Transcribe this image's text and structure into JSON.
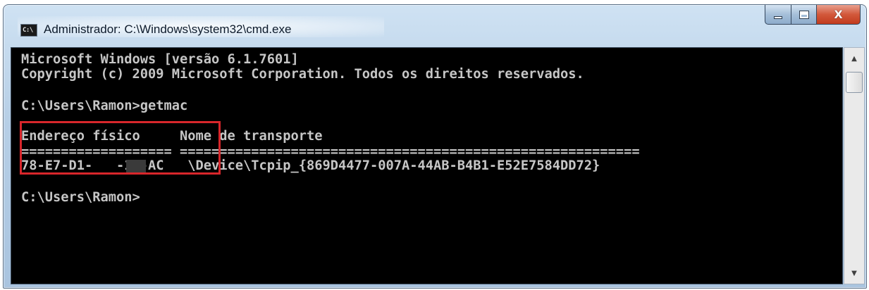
{
  "window": {
    "title": "Administrador: C:\\Windows\\system32\\cmd.exe",
    "icon_text": "C:\\"
  },
  "caption_buttons": {
    "minimize_icon": "minimize-icon",
    "maximize_icon": "maximize-icon",
    "close_glyph": "X"
  },
  "console": {
    "lines": [
      "Microsoft Windows [versão 6.1.7601]",
      "Copyright (c) 2009 Microsoft Corporation. Todos os direitos reservados.",
      "",
      "C:\\Users\\Ramon>getmac",
      "",
      "Endereço físico     Nome de transporte",
      "=================== ==========================================================",
      "78-E7-D1-   -1B-AC   \\Device\\Tcpip_{869D4477-007A-44AB-B4B1-E52E7584DD72}",
      "",
      "C:\\Users\\Ramon>"
    ]
  },
  "highlight": {
    "color": "#d8262b"
  },
  "scrollbar": {
    "up_glyph": "▲",
    "down_glyph": "▼"
  }
}
